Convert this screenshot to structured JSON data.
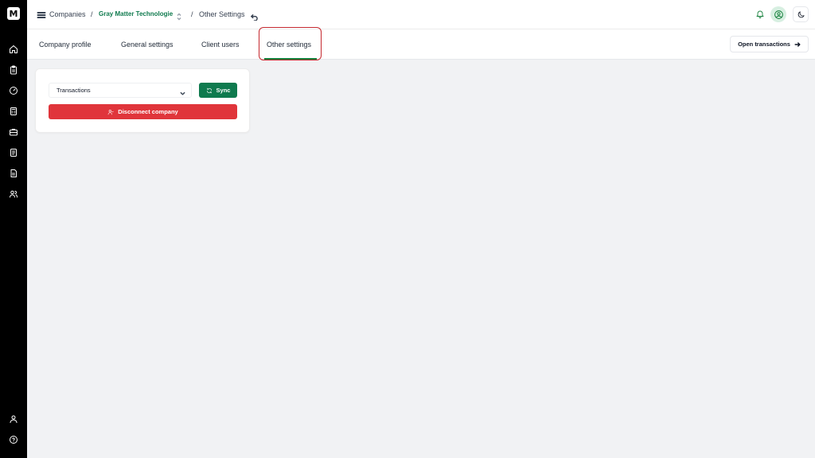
{
  "sidebar": {
    "logo_text": "M",
    "top_icons": [
      "home-icon",
      "clipboard-icon",
      "gauge-icon",
      "calculator-icon",
      "briefcase-icon",
      "document-icon",
      "report-icon",
      "users-icon"
    ],
    "bottom_icons": [
      "user-icon",
      "help-icon"
    ]
  },
  "header": {
    "menu_icon": "menu-icon",
    "breadcrumb": {
      "root": "Companies",
      "separator": "/",
      "company": "Gray Matter Technologie",
      "current": "Other Settings"
    },
    "icons": [
      "bell-icon",
      "user-circle-icon",
      "moon-icon"
    ]
  },
  "tabs": {
    "items": [
      {
        "label": "Company profile"
      },
      {
        "label": "General settings"
      },
      {
        "label": "Client users"
      },
      {
        "label": "Other settings"
      }
    ],
    "active": "Other settings",
    "open_transactions_label": "Open transactions"
  },
  "card": {
    "select_value": "Transactions",
    "sync_label": "Sync",
    "disconnect_label": "Disconnect company"
  },
  "colors": {
    "accent_green": "#0f7a4e",
    "danger_red": "#e0353b",
    "sidebar_bg": "#000000",
    "page_bg": "#f1f2f4"
  }
}
